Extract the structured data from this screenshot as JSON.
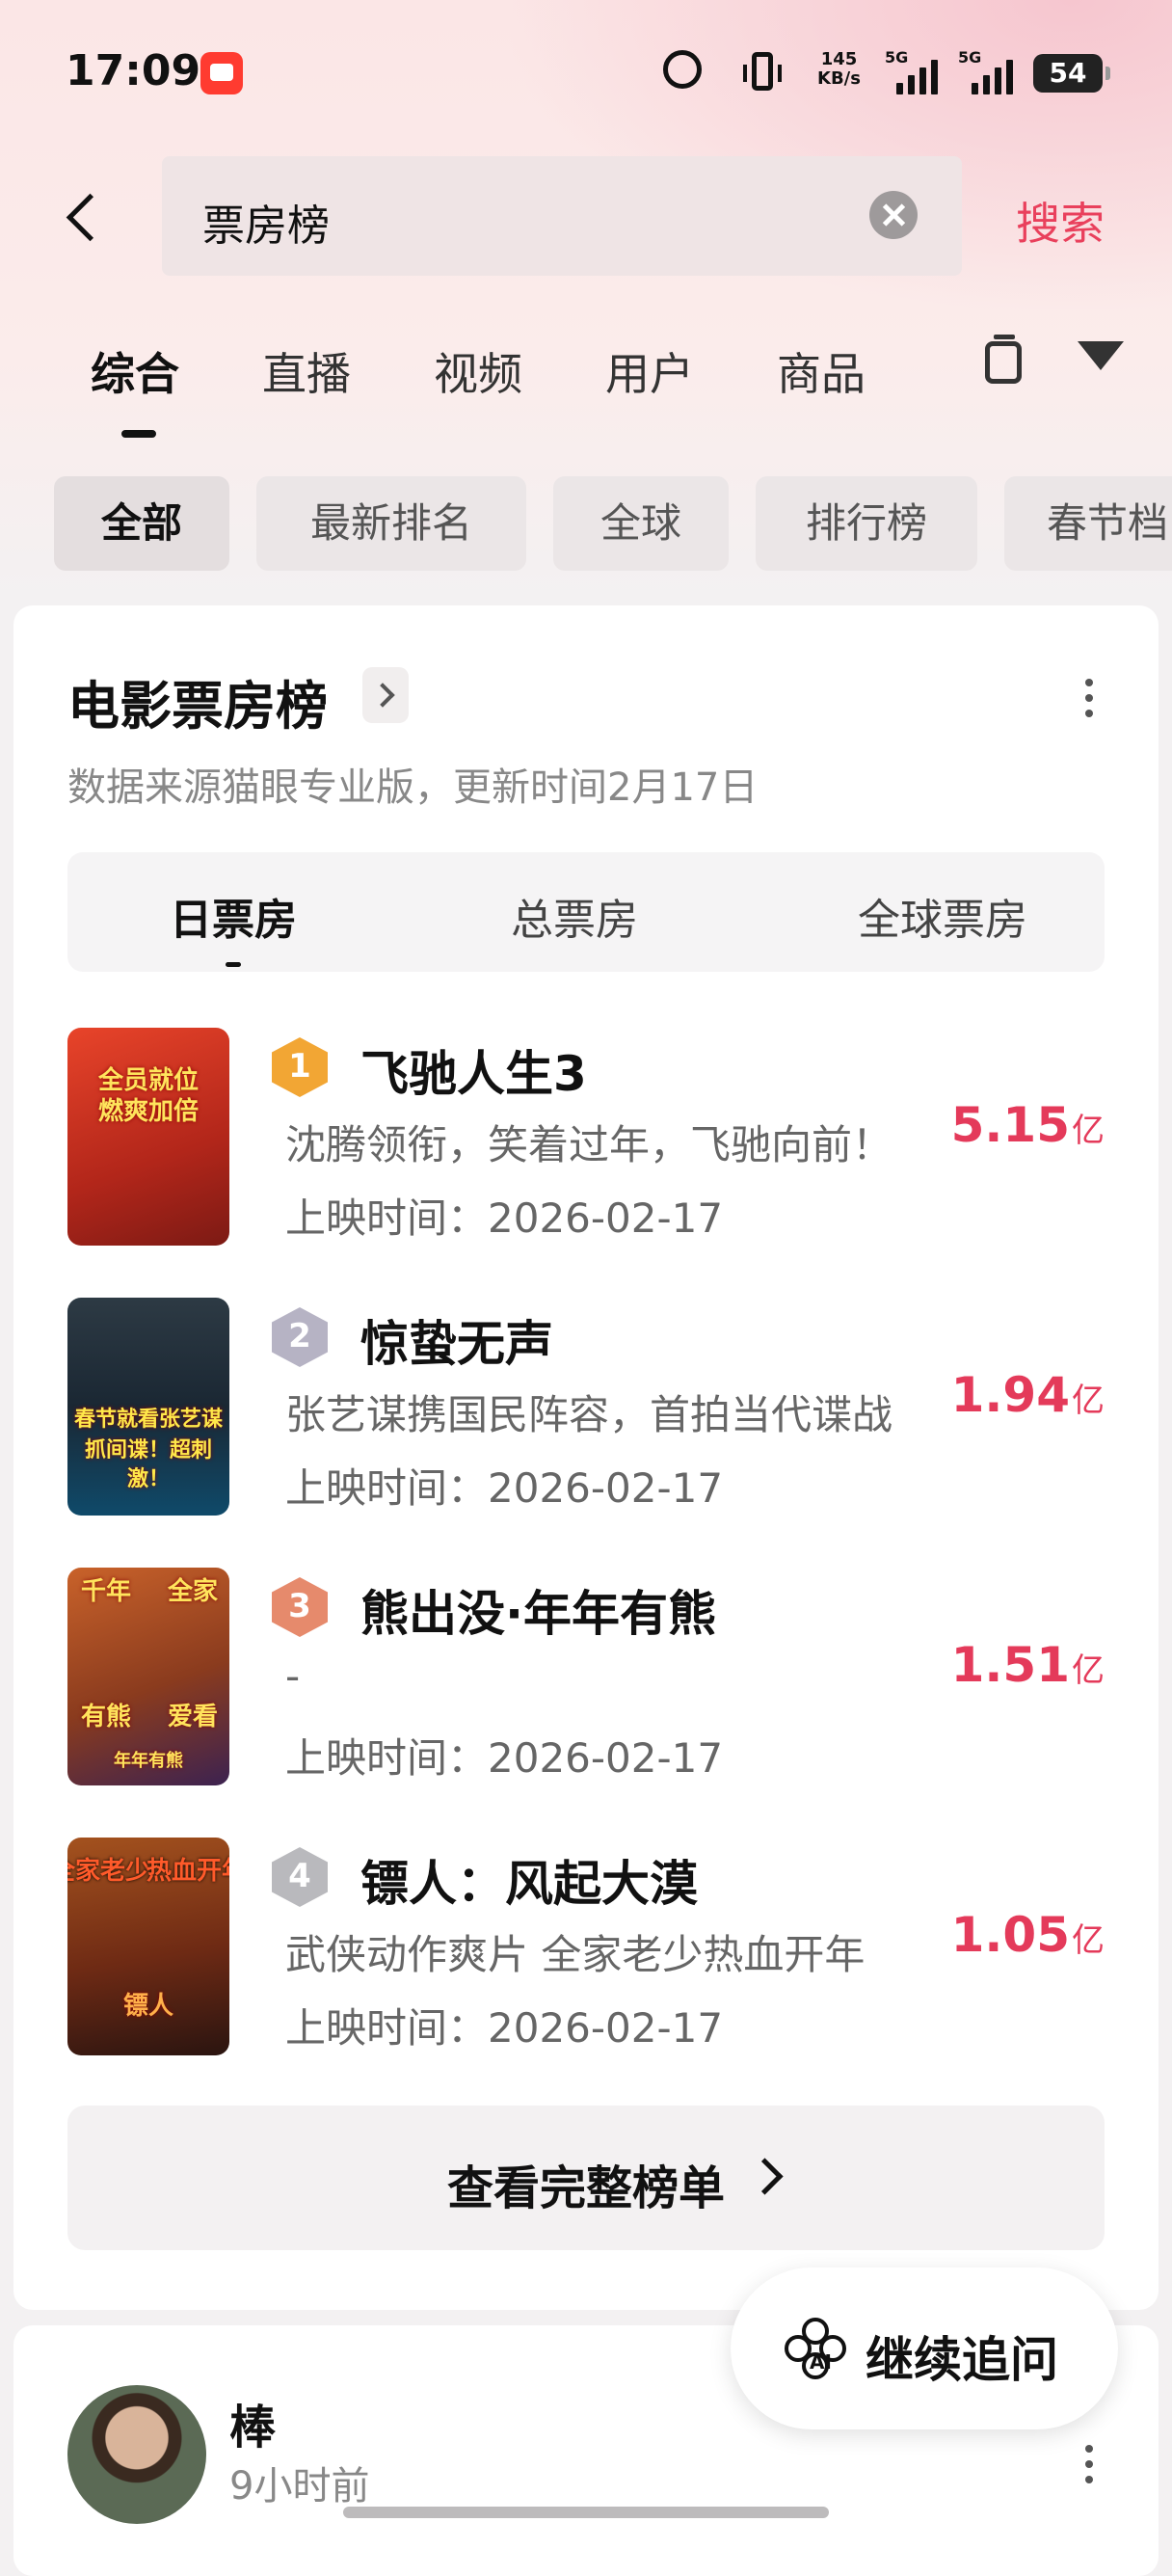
{
  "status_bar": {
    "time": "17:09",
    "net_speed_value": "145",
    "net_speed_unit": "KB/s",
    "signal1_label": "5G",
    "signal2_label": "5G",
    "battery": "54",
    "icons": [
      "app-notification-icon",
      "alarm-icon",
      "vibrate-icon",
      "signal-icon",
      "battery-icon"
    ]
  },
  "search": {
    "query": "票房榜",
    "button": "搜索"
  },
  "tabs": {
    "items": [
      "综合",
      "直播",
      "视频",
      "用户",
      "商品"
    ],
    "active": "综合"
  },
  "chips": {
    "items": [
      "全部",
      "最新排名",
      "全球",
      "排行榜",
      "春节档"
    ],
    "active": "全部"
  },
  "box_office": {
    "title": "电影票房榜",
    "subtitle": "数据来源猫眼专业版，更新时间2月17日",
    "segments": [
      "日票房",
      "总票房",
      "全球票房"
    ],
    "active_segment": "日票房",
    "date_prefix": "上映时间：",
    "movies": [
      {
        "rank": "1",
        "title": "飞驰人生3",
        "desc": "沈腾领衔，笑着过年，飞驰向前！",
        "date": "2026-02-17",
        "value": "5.15",
        "unit": "亿",
        "poster_text": [
          "全员就位",
          "燃爽加倍"
        ],
        "badge_color": "#f2a634"
      },
      {
        "rank": "2",
        "title": "惊蛰无声",
        "desc": "张艺谋携国民阵容，首拍当代谍战",
        "date": "2026-02-17",
        "value": "1.94",
        "unit": "亿",
        "poster_text": [
          "春节就看张艺谋",
          "抓间谍！超刺激！"
        ],
        "badge_color": "#b6b3c4"
      },
      {
        "rank": "3",
        "title": "熊出没·年年有熊",
        "desc": "-",
        "date": "2026-02-17",
        "value": "1.51",
        "unit": "亿",
        "poster_text": [
          "千年",
          "全家",
          "有熊",
          "爱看",
          "年年有熊"
        ],
        "badge_color": "#e68a6c"
      },
      {
        "rank": "4",
        "title": "镖人：风起大漠",
        "desc": "武侠动作爽片 全家老少热血开年",
        "date": "2026-02-17",
        "value": "1.05",
        "unit": "亿",
        "poster_text": [
          "全家老少",
          "热血开年",
          "镖人"
        ],
        "badge_color": "#b9b9bd"
      }
    ],
    "view_full": "查看完整榜单"
  },
  "post": {
    "user_name": "棒",
    "time_ago": "9小时前"
  },
  "ai_button": {
    "icon_label": "AI",
    "text": "继续追问"
  },
  "colors": {
    "accent": "#e9405c",
    "value_red": "#e43a5a",
    "background": "#f3f1f2"
  }
}
